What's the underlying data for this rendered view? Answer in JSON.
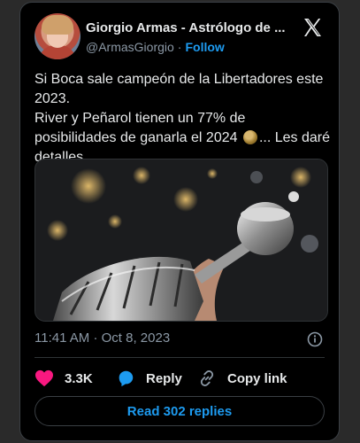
{
  "author": {
    "name": "Giorgio Armas - Astrólogo de ...",
    "handle": "@ArmasGiorgio",
    "separator": "·",
    "follow_label": "Follow"
  },
  "tweet": {
    "line1": "Si Boca sale campeón de la Libertadores este 2023.",
    "line2_before_emoji": "River y Peñarol tienen un 77% de posibilidades de ganarla el 2024",
    "line2_after_emoji": "... Les daré detalles",
    "emoji": "smirk-face-emoji"
  },
  "media": {
    "alt": "copa-libertadores-trophy-photo"
  },
  "meta": {
    "time": "11:41 AM",
    "separator": "·",
    "date": "Oct 8, 2023"
  },
  "actions": {
    "likes": "3.3K",
    "reply_label": "Reply",
    "copy_label": "Copy link"
  },
  "read_replies_label": "Read 302 replies",
  "colors": {
    "accent": "#1d9bf0",
    "like": "#f91880",
    "text": "#e7e9ea",
    "muted": "#8b98a5",
    "background": "#000000"
  }
}
